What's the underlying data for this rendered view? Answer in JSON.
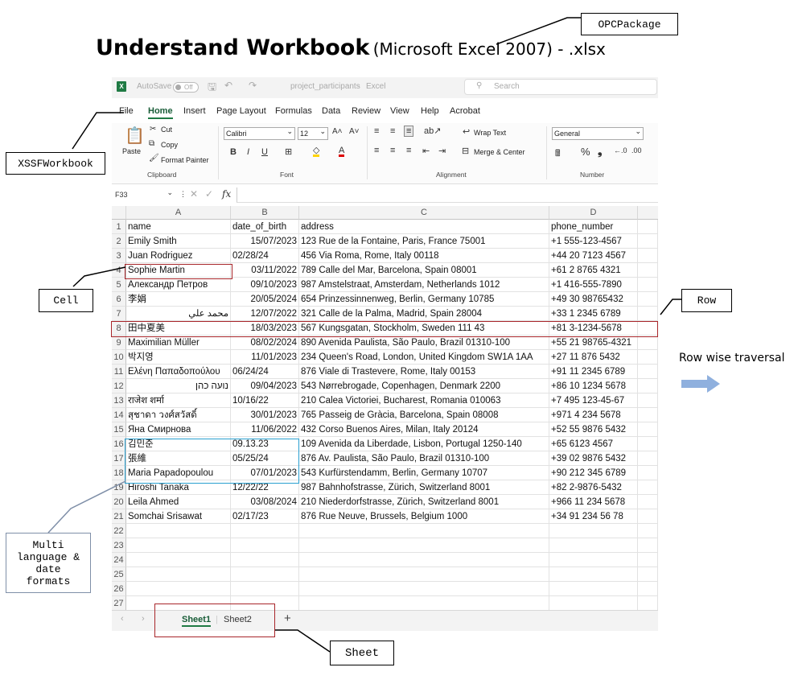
{
  "heading": {
    "bold": "Understand Workbook",
    "rest": "(Microsoft Excel 2007) - .xlsx"
  },
  "callouts": {
    "opc": "OPCPackage",
    "workbook": "XSSFWorkbook",
    "cell": "Cell",
    "row": "Row",
    "multi": "Multi language & date formats",
    "sheet": "Sheet",
    "traversal": "Row wise traversal"
  },
  "excel": {
    "autosave": "AutoSave",
    "autosave_state": "Off",
    "filename": "project_participants",
    "app": "Excel",
    "search_placeholder": "Search",
    "menus": [
      "File",
      "Home",
      "Insert",
      "Page Layout",
      "Formulas",
      "Data",
      "Review",
      "View",
      "Help",
      "Acrobat"
    ],
    "active_menu": "Home",
    "clipboard": {
      "paste": "Paste",
      "cut": "Cut",
      "copy": "Copy",
      "format_painter": "Format Painter",
      "group": "Clipboard"
    },
    "font": {
      "name": "Calibri",
      "size": "12",
      "bold": "B",
      "italic": "I",
      "underline": "U",
      "group": "Font"
    },
    "alignment": {
      "wrap": "Wrap Text",
      "merge": "Merge & Center",
      "group": "Alignment"
    },
    "number": {
      "format": "General",
      "group": "Number"
    },
    "name_box": "F33",
    "fx": "fx",
    "columns": [
      "A",
      "B",
      "C",
      "D"
    ],
    "rows": [
      {
        "n": "1",
        "a": "name",
        "b": "date_of_birth",
        "b_align": "l",
        "c": "address",
        "d": "phone_number"
      },
      {
        "n": "2",
        "a": "Emily Smith",
        "b": "15/07/2023",
        "b_align": "r",
        "c": "123 Rue de la Fontaine, Paris, France 75001",
        "d": "+1 555-123-4567"
      },
      {
        "n": "3",
        "a": "Juan Rodriguez",
        "b": "02/28/24",
        "b_align": "l",
        "c": "456 Via Roma, Rome, Italy 00118",
        "d": "+44 20 7123 4567"
      },
      {
        "n": "4",
        "a": "Sophie Martin",
        "b": "03/11/2022",
        "b_align": "r",
        "c": "789 Calle del Mar, Barcelona, Spain 08001",
        "d": "+61 2 8765 4321"
      },
      {
        "n": "5",
        "a": "Александр Петров",
        "b": "09/10/2023",
        "b_align": "r",
        "c": "987 Amstelstraat, Amsterdam, Netherlands 1012",
        "d": "+1 416-555-7890"
      },
      {
        "n": "6",
        "a": "李娟",
        "b": "20/05/2024",
        "b_align": "r",
        "c": "654 Prinzessinnenweg, Berlin, Germany 10785",
        "d": "+49 30 98765432"
      },
      {
        "n": "7",
        "a": "محمد علي",
        "a_align": "r",
        "b": "12/07/2022",
        "b_align": "r",
        "c": "321 Calle de la Palma, Madrid, Spain 28004",
        "d": "+33 1 2345 6789"
      },
      {
        "n": "8",
        "a": "田中夏美",
        "b": "18/03/2023",
        "b_align": "r",
        "c": "567 Kungsgatan, Stockholm, Sweden 111 43",
        "d": "+81 3-1234-5678"
      },
      {
        "n": "9",
        "a": "Maximilian Müller",
        "b": "08/02/2024",
        "b_align": "r",
        "c": "890 Avenida Paulista, São Paulo, Brazil 01310-100",
        "d": "+55 21 98765-4321"
      },
      {
        "n": "10",
        "a": "박지영",
        "b": "11/01/2023",
        "b_align": "r",
        "c": "234 Queen's Road, London, United Kingdom SW1A 1AA",
        "d": "+27 11 876 5432"
      },
      {
        "n": "11",
        "a": "Ελένη Παπαδοπούλου",
        "b": "06/24/24",
        "b_align": "l",
        "c": "876 Viale di Trastevere, Rome, Italy 00153",
        "d": "+91 11 2345 6789"
      },
      {
        "n": "12",
        "a": "נועה כהן",
        "a_align": "r",
        "b": "09/04/2023",
        "b_align": "r",
        "c": "543 Nørrebrogade, Copenhagen, Denmark 2200",
        "d": "+86 10 1234 5678"
      },
      {
        "n": "13",
        "a": "राजेश शर्मा",
        "b": "10/16/22",
        "b_align": "l",
        "c": "210 Calea Victoriei, Bucharest, Romania 010063",
        "d": "+7 495 123-45-67"
      },
      {
        "n": "14",
        "a": "สุชาดา วงศ์สวัสดิ์",
        "b": "30/01/2023",
        "b_align": "r",
        "c": "765 Passeig de Gràcia, Barcelona, Spain 08008",
        "d": "+971 4 234 5678"
      },
      {
        "n": "15",
        "a": "Яна Смирнова",
        "b": "11/06/2022",
        "b_align": "r",
        "c": "432 Corso Buenos Aires, Milan, Italy 20124",
        "d": "+52 55 9876 5432"
      },
      {
        "n": "16",
        "a": "김민준",
        "b": "09.13.23",
        "b_align": "l",
        "c": "109 Avenida da Liberdade, Lisbon, Portugal 1250-140",
        "d": "+65 6123 4567"
      },
      {
        "n": "17",
        "a": "張維",
        "b": "05/25/24",
        "b_align": "l",
        "c": "876 Av. Paulista, São Paulo, Brazil 01310-100",
        "d": "+39 02 9876 5432"
      },
      {
        "n": "18",
        "a": "Maria Papadopoulou",
        "b": "07/01/2023",
        "b_align": "r",
        "c": "543 Kurfürstendamm, Berlin, Germany 10707",
        "d": "+90 212 345 6789"
      },
      {
        "n": "19",
        "a": "Hiroshi Tanaka",
        "b": "12/22/22",
        "b_align": "l",
        "c": "987 Bahnhofstrasse, Zürich, Switzerland 8001",
        "d": "+82 2-9876-5432"
      },
      {
        "n": "20",
        "a": "Leila Ahmed",
        "b": "03/08/2024",
        "b_align": "r",
        "c": "210 Niederdorfstrasse, Zürich, Switzerland 8001",
        "d": "+966 11 234 5678"
      },
      {
        "n": "21",
        "a": "Somchai Srisawat",
        "b": "02/17/23",
        "b_align": "l",
        "c": "876 Rue Neuve, Brussels, Belgium 1000",
        "d": "+34 91 234 56 78"
      },
      {
        "n": "22",
        "a": "",
        "b": "",
        "c": "",
        "d": ""
      },
      {
        "n": "23",
        "a": "",
        "b": "",
        "c": "",
        "d": ""
      },
      {
        "n": "24",
        "a": "",
        "b": "",
        "c": "",
        "d": ""
      },
      {
        "n": "25",
        "a": "",
        "b": "",
        "c": "",
        "d": ""
      },
      {
        "n": "26",
        "a": "",
        "b": "",
        "c": "",
        "d": ""
      },
      {
        "n": "27",
        "a": "",
        "b": "",
        "c": "",
        "d": ""
      }
    ],
    "sheets": [
      "Sheet1",
      "Sheet2"
    ],
    "active_sheet": "Sheet1",
    "add_sheet": "+"
  },
  "colors": {
    "highlight_red": "#a8262a",
    "highlight_blue": "#2aa0d0",
    "excel_green": "#1f7a44",
    "arrow_blue": "#8fb0de"
  }
}
